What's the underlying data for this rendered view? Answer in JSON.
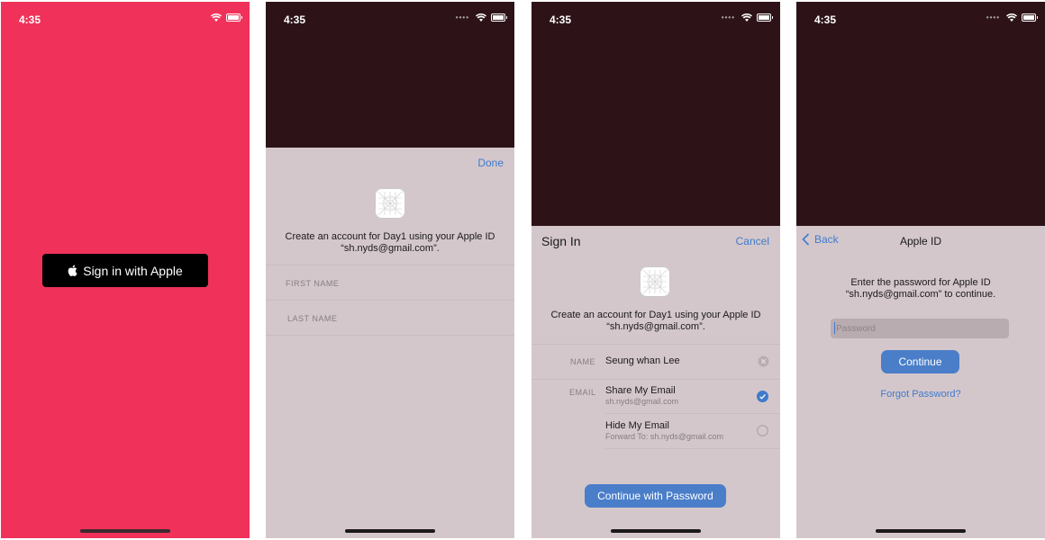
{
  "status": {
    "time": "4:35"
  },
  "screen1": {
    "sign_in_button": "Sign in with Apple"
  },
  "screen2": {
    "done": "Done",
    "message_line1": "Create an account for Day1 using your Apple ID",
    "message_line2": "“sh.nyds@gmail.com”.",
    "first_name_placeholder": "FIRST NAME",
    "last_name_placeholder": "LAST NAME"
  },
  "screen3": {
    "title": "Sign In",
    "cancel": "Cancel",
    "message_line1": "Create an account for Day1 using your Apple ID",
    "message_line2": "“sh.nyds@gmail.com”.",
    "name_label": "NAME",
    "name_value": "Seung whan Lee",
    "email_label": "EMAIL",
    "share_email_title": "Share My Email",
    "share_email_value": "sh.nyds@gmail.com",
    "hide_email_title": "Hide My Email",
    "hide_email_value": "Forward To: sh.nyds@gmail.com",
    "continue_password": "Continue with Password",
    "selected_email_option": "Share My Email"
  },
  "screen4": {
    "back": "Back",
    "title": "Apple ID",
    "message_line1": "Enter the password for Apple ID",
    "message_line2": "“sh.nyds@gmail.com” to continue.",
    "password_placeholder": "Password",
    "continue": "Continue",
    "forgot": "Forgot Password?"
  },
  "colors": {
    "screen1_background": "#f0325a",
    "dark_backdrop": "#2d1317",
    "sheet_background": "#d4c7cb",
    "accent": "#3f7bcc",
    "button_blue": "#4a7ec9"
  }
}
